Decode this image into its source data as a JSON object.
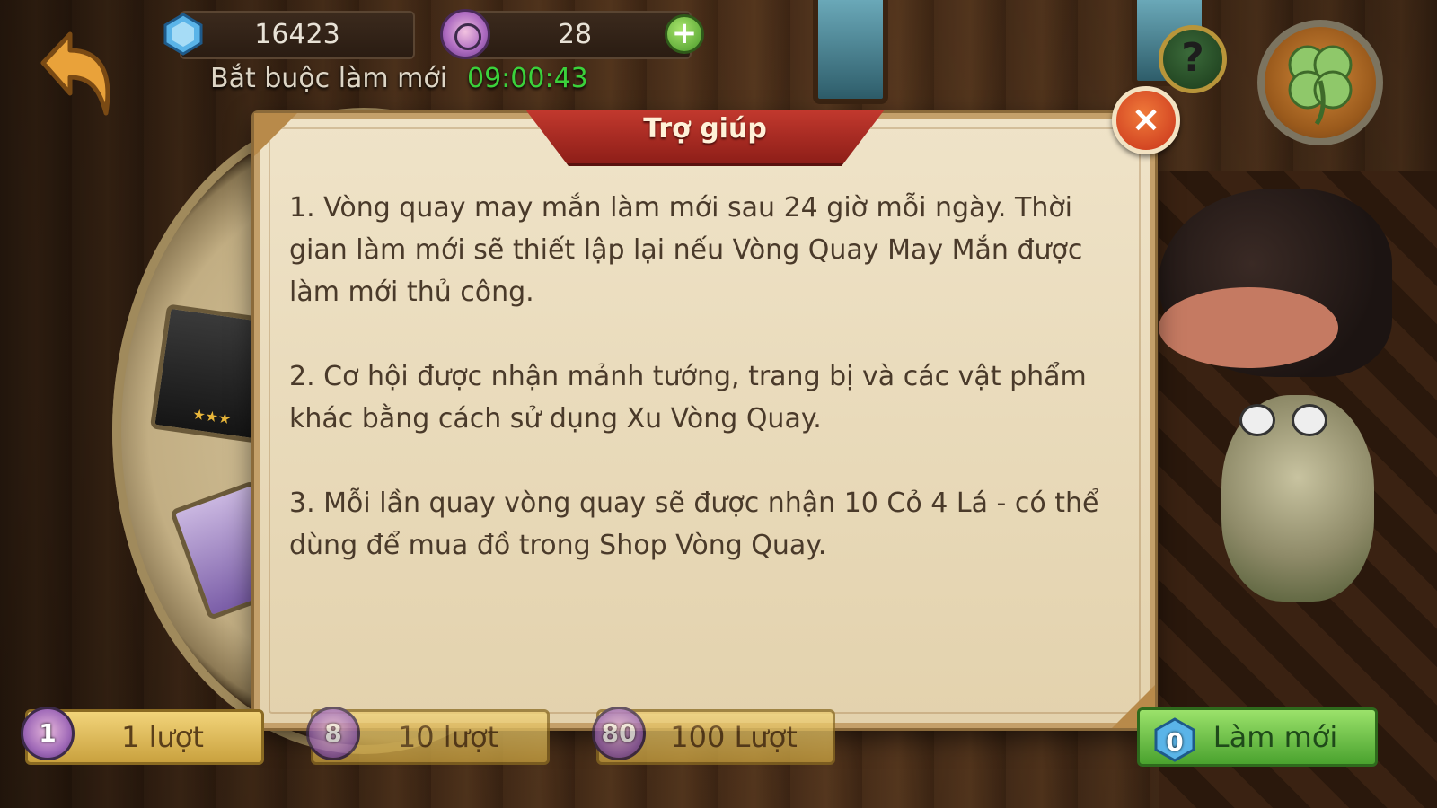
{
  "header": {
    "gems": "16423",
    "spin_coins": "28",
    "refresh_label": "Bắt buộc làm mới",
    "refresh_timer": "09:00:43",
    "plus_symbol": "+",
    "help_symbol": "?"
  },
  "dialog": {
    "title": "Trợ giúp",
    "close_symbol": "×",
    "paragraphs": [
      "1. Vòng quay may mắn làm mới sau 24 giờ mỗi ngày. Thời gian làm mới sẽ thiết lập lại nếu Vòng Quay May Mắn được làm mới thủ công.",
      "2. Cơ hội được nhận mảnh tướng, trang bị và các vật phẩm khác bằng cách sử dụng Xu Vòng Quay.",
      "3. Mỗi lần quay vòng quay sẽ được nhận 10 Cỏ 4 Lá - có thể dùng để mua đồ trong Shop Vòng Quay."
    ]
  },
  "footer": {
    "spin_buttons": [
      {
        "cost": "1",
        "label": "1 lượt"
      },
      {
        "cost": "8",
        "label": "10 lượt"
      },
      {
        "cost": "80",
        "label": "100 Lượt"
      }
    ],
    "refresh_button": {
      "cost": "0",
      "label": "Làm mới"
    }
  },
  "icons": {
    "back": "back-arrow-icon",
    "gem": "gem-icon",
    "coin": "spin-coin-icon",
    "plus": "plus-icon",
    "help": "help-icon",
    "clover": "four-leaf-clover-icon",
    "close": "close-icon"
  },
  "colors": {
    "timer": "#3bd13b",
    "dialog_bg": "#efe3c8",
    "ribbon": "#c2392e",
    "close": "#e0522a",
    "spin_button": "#e6c45e",
    "refresh_button": "#7cc84e"
  }
}
